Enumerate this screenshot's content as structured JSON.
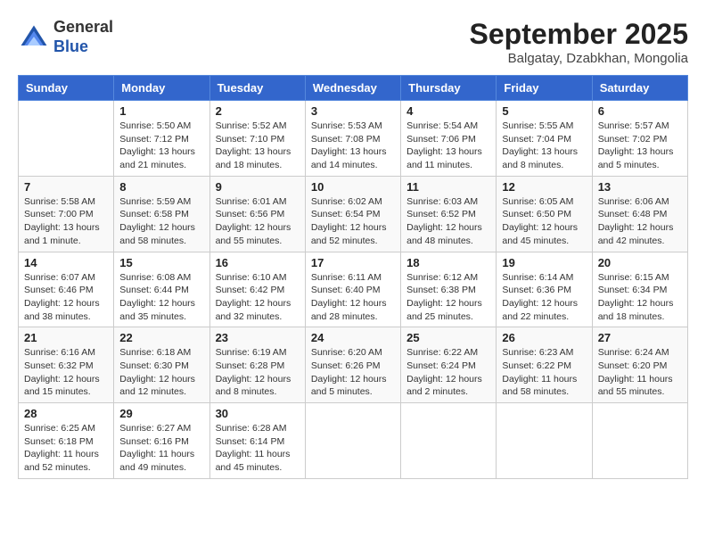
{
  "header": {
    "logo_general": "General",
    "logo_blue": "Blue",
    "month_title": "September 2025",
    "location": "Balgatay, Dzabkhan, Mongolia"
  },
  "days_of_week": [
    "Sunday",
    "Monday",
    "Tuesday",
    "Wednesday",
    "Thursday",
    "Friday",
    "Saturday"
  ],
  "weeks": [
    [
      {
        "day": "",
        "info": ""
      },
      {
        "day": "1",
        "info": "Sunrise: 5:50 AM\nSunset: 7:12 PM\nDaylight: 13 hours\nand 21 minutes."
      },
      {
        "day": "2",
        "info": "Sunrise: 5:52 AM\nSunset: 7:10 PM\nDaylight: 13 hours\nand 18 minutes."
      },
      {
        "day": "3",
        "info": "Sunrise: 5:53 AM\nSunset: 7:08 PM\nDaylight: 13 hours\nand 14 minutes."
      },
      {
        "day": "4",
        "info": "Sunrise: 5:54 AM\nSunset: 7:06 PM\nDaylight: 13 hours\nand 11 minutes."
      },
      {
        "day": "5",
        "info": "Sunrise: 5:55 AM\nSunset: 7:04 PM\nDaylight: 13 hours\nand 8 minutes."
      },
      {
        "day": "6",
        "info": "Sunrise: 5:57 AM\nSunset: 7:02 PM\nDaylight: 13 hours\nand 5 minutes."
      }
    ],
    [
      {
        "day": "7",
        "info": "Sunrise: 5:58 AM\nSunset: 7:00 PM\nDaylight: 13 hours\nand 1 minute."
      },
      {
        "day": "8",
        "info": "Sunrise: 5:59 AM\nSunset: 6:58 PM\nDaylight: 12 hours\nand 58 minutes."
      },
      {
        "day": "9",
        "info": "Sunrise: 6:01 AM\nSunset: 6:56 PM\nDaylight: 12 hours\nand 55 minutes."
      },
      {
        "day": "10",
        "info": "Sunrise: 6:02 AM\nSunset: 6:54 PM\nDaylight: 12 hours\nand 52 minutes."
      },
      {
        "day": "11",
        "info": "Sunrise: 6:03 AM\nSunset: 6:52 PM\nDaylight: 12 hours\nand 48 minutes."
      },
      {
        "day": "12",
        "info": "Sunrise: 6:05 AM\nSunset: 6:50 PM\nDaylight: 12 hours\nand 45 minutes."
      },
      {
        "day": "13",
        "info": "Sunrise: 6:06 AM\nSunset: 6:48 PM\nDaylight: 12 hours\nand 42 minutes."
      }
    ],
    [
      {
        "day": "14",
        "info": "Sunrise: 6:07 AM\nSunset: 6:46 PM\nDaylight: 12 hours\nand 38 minutes."
      },
      {
        "day": "15",
        "info": "Sunrise: 6:08 AM\nSunset: 6:44 PM\nDaylight: 12 hours\nand 35 minutes."
      },
      {
        "day": "16",
        "info": "Sunrise: 6:10 AM\nSunset: 6:42 PM\nDaylight: 12 hours\nand 32 minutes."
      },
      {
        "day": "17",
        "info": "Sunrise: 6:11 AM\nSunset: 6:40 PM\nDaylight: 12 hours\nand 28 minutes."
      },
      {
        "day": "18",
        "info": "Sunrise: 6:12 AM\nSunset: 6:38 PM\nDaylight: 12 hours\nand 25 minutes."
      },
      {
        "day": "19",
        "info": "Sunrise: 6:14 AM\nSunset: 6:36 PM\nDaylight: 12 hours\nand 22 minutes."
      },
      {
        "day": "20",
        "info": "Sunrise: 6:15 AM\nSunset: 6:34 PM\nDaylight: 12 hours\nand 18 minutes."
      }
    ],
    [
      {
        "day": "21",
        "info": "Sunrise: 6:16 AM\nSunset: 6:32 PM\nDaylight: 12 hours\nand 15 minutes."
      },
      {
        "day": "22",
        "info": "Sunrise: 6:18 AM\nSunset: 6:30 PM\nDaylight: 12 hours\nand 12 minutes."
      },
      {
        "day": "23",
        "info": "Sunrise: 6:19 AM\nSunset: 6:28 PM\nDaylight: 12 hours\nand 8 minutes."
      },
      {
        "day": "24",
        "info": "Sunrise: 6:20 AM\nSunset: 6:26 PM\nDaylight: 12 hours\nand 5 minutes."
      },
      {
        "day": "25",
        "info": "Sunrise: 6:22 AM\nSunset: 6:24 PM\nDaylight: 12 hours\nand 2 minutes."
      },
      {
        "day": "26",
        "info": "Sunrise: 6:23 AM\nSunset: 6:22 PM\nDaylight: 11 hours\nand 58 minutes."
      },
      {
        "day": "27",
        "info": "Sunrise: 6:24 AM\nSunset: 6:20 PM\nDaylight: 11 hours\nand 55 minutes."
      }
    ],
    [
      {
        "day": "28",
        "info": "Sunrise: 6:25 AM\nSunset: 6:18 PM\nDaylight: 11 hours\nand 52 minutes."
      },
      {
        "day": "29",
        "info": "Sunrise: 6:27 AM\nSunset: 6:16 PM\nDaylight: 11 hours\nand 49 minutes."
      },
      {
        "day": "30",
        "info": "Sunrise: 6:28 AM\nSunset: 6:14 PM\nDaylight: 11 hours\nand 45 minutes."
      },
      {
        "day": "",
        "info": ""
      },
      {
        "day": "",
        "info": ""
      },
      {
        "day": "",
        "info": ""
      },
      {
        "day": "",
        "info": ""
      }
    ]
  ]
}
